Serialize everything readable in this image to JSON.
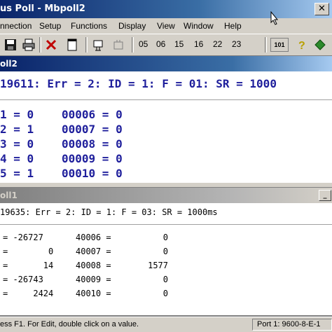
{
  "window": {
    "title": "us Poll - Mbpoll2",
    "close_glyph": "✕"
  },
  "menu": {
    "items": [
      "nnection",
      "Setup",
      "Functions",
      "Display",
      "View",
      "Window",
      "Help"
    ]
  },
  "toolbar": {
    "function_codes": [
      "05",
      "06",
      "15",
      "16",
      "22",
      "23"
    ],
    "btn_101": "101",
    "icons": [
      "save-icon",
      "print-icon",
      "delete-icon",
      "new-window-icon",
      "read-write-icon",
      "disconnect-icon",
      "help-icon",
      "about-icon"
    ]
  },
  "window1": {
    "title": "oll2",
    "status_line": "19611: Err = 2: ID = 1: F = 01: SR = 1000",
    "rows": [
      {
        "left": "1 = 0",
        "right": "00006 = 0"
      },
      {
        "left": "2 = 1",
        "right": "00007 = 0"
      },
      {
        "left": "3 = 0",
        "right": "00008 = 0"
      },
      {
        "left": "4 = 0",
        "right": "00009 = 0"
      },
      {
        "left": "5 = 1",
        "right": "00010 = 0"
      }
    ]
  },
  "window2": {
    "title": "oll1",
    "status_line": "19635: Err = 2: ID = 1: F = 03: SR = 1000ms",
    "rows": [
      {
        "left": "= -26727",
        "addr": "40006 =",
        "value": "0"
      },
      {
        "left": "=        0",
        "addr": "40007 =",
        "value": "0"
      },
      {
        "left": "=       14",
        "addr": "40008 =",
        "value": "1577"
      },
      {
        "left": "= -26743",
        "addr": "40009 =",
        "value": "0"
      },
      {
        "left": "=     2424",
        "addr": "40010 =",
        "value": "0"
      }
    ],
    "minimize_glyph": "_"
  },
  "statusbar": {
    "help": "ess F1.  For Edit, double click on a value.",
    "port": "Port 1: 9600-8-E-1"
  },
  "colors": {
    "accent": "#0a246a",
    "register_text": "#1f1f9c"
  }
}
